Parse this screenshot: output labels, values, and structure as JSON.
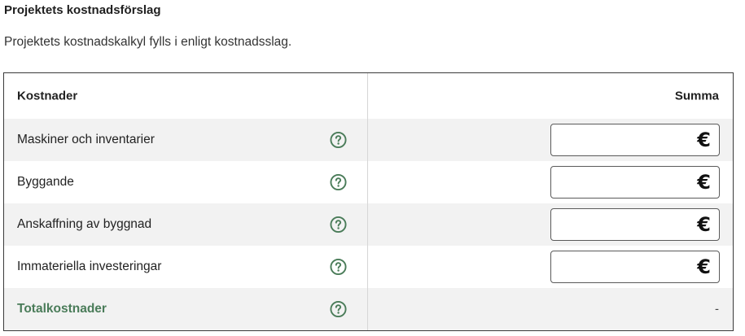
{
  "section": {
    "title": "Projektets kostnadsförslag",
    "description": "Projektets kostnadskalkyl fylls i enligt kostnadsslag."
  },
  "table": {
    "header": {
      "costs_label": "Kostnader",
      "sum_label": "Summa"
    },
    "rows": [
      {
        "label": "Maskiner och inventarier",
        "value": "",
        "currency": "€"
      },
      {
        "label": "Byggande",
        "value": "",
        "currency": "€"
      },
      {
        "label": "Anskaffning av byggnad",
        "value": "",
        "currency": "€"
      },
      {
        "label": "Immateriella investeringar",
        "value": "",
        "currency": "€"
      }
    ],
    "total": {
      "label": "Totalkostnader",
      "value": "-"
    }
  },
  "colors": {
    "accent_green": "#4a7c59",
    "row_shade": "#f2f2f2",
    "border": "#3a3a3a"
  },
  "icons": {
    "help": "question-circle-icon"
  }
}
